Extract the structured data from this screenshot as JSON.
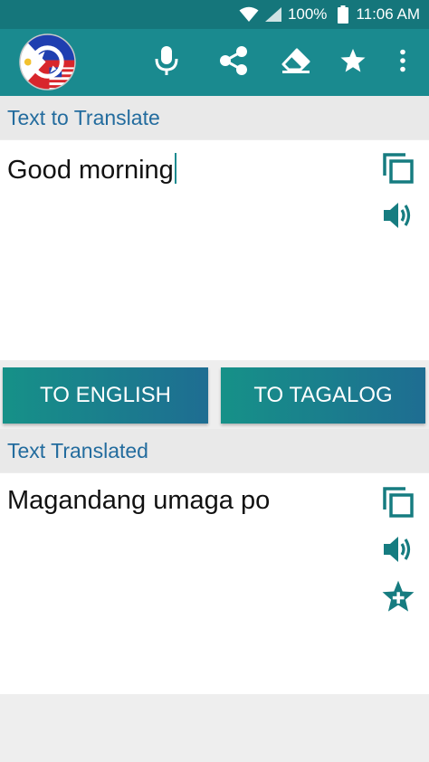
{
  "status_bar": {
    "battery": "100%",
    "time": "11:06 AM",
    "icons": [
      "wifi-icon",
      "signal-icon",
      "battery-icon"
    ]
  },
  "app_bar": {
    "logo": "philippines-usa-translator-logo",
    "actions": [
      "microphone-icon",
      "share-icon",
      "eraser-icon",
      "star-icon",
      "more-vert-icon"
    ],
    "accent_color": "#1a8a8f"
  },
  "input_section": {
    "label": "Text to Translate",
    "value": "Good morning"
  },
  "buttons": {
    "to_english": "TO ENGLISH",
    "to_tagalog": "TO TAGALOG"
  },
  "output_section": {
    "label": "Text Translated",
    "value": "Magandang umaga po"
  },
  "colors": {
    "status_bar": "#15767b",
    "app_bar": "#1a8a8f",
    "label_text": "#236c9e",
    "icon": "#167c80"
  }
}
